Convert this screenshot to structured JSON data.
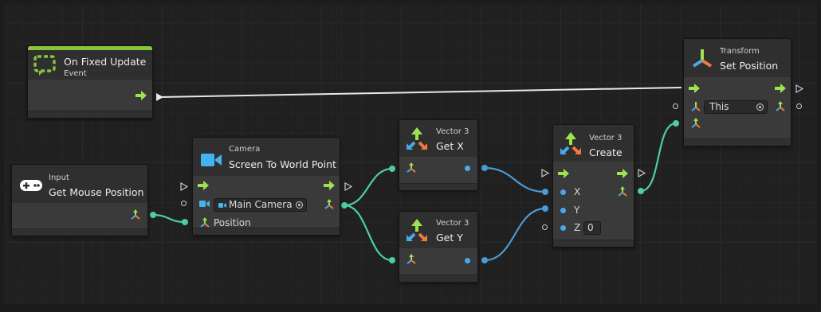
{
  "graph": {
    "nodes": {
      "on_fixed_update": {
        "title": "On Fixed Update",
        "subtitle": "Event",
        "accent": "#8ac43f"
      },
      "get_mouse_position": {
        "category": "Input",
        "title": "Get Mouse Position"
      },
      "screen_to_world": {
        "category": "Camera",
        "title": "Screen To World Point",
        "camera_value": "Main Camera",
        "position_label": "Position"
      },
      "get_x": {
        "category": "Vector 3",
        "title": "Get X"
      },
      "get_y": {
        "category": "Vector 3",
        "title": "Get Y"
      },
      "create": {
        "category": "Vector 3",
        "title": "Create",
        "x_label": "X",
        "y_label": "Y",
        "z_label": "Z",
        "z_value": "0"
      },
      "set_position": {
        "category": "Transform",
        "title": "Set Position",
        "target_value": "This"
      }
    },
    "colors": {
      "flow": "#9de24f",
      "vector3_wire": "#4ecda2",
      "float_wire": "#4a9bd6",
      "flow_wire": "#e8e8e8",
      "camera_icon": "#43b4f0"
    }
  }
}
